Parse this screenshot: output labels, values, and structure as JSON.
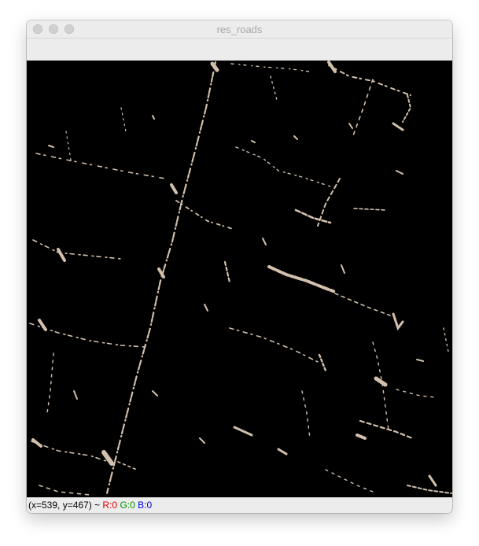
{
  "window": {
    "title": "res_roads"
  },
  "status": {
    "coords": "(x=539, y=467) ~ ",
    "r": "R:0",
    "g": "G:0",
    "b": "B:0",
    "r_color": "#e00000",
    "g_color": "#009000",
    "b_color": "#0000e0"
  },
  "colors": {
    "road_pixel": "#d2c0ad",
    "background": "#000000"
  }
}
